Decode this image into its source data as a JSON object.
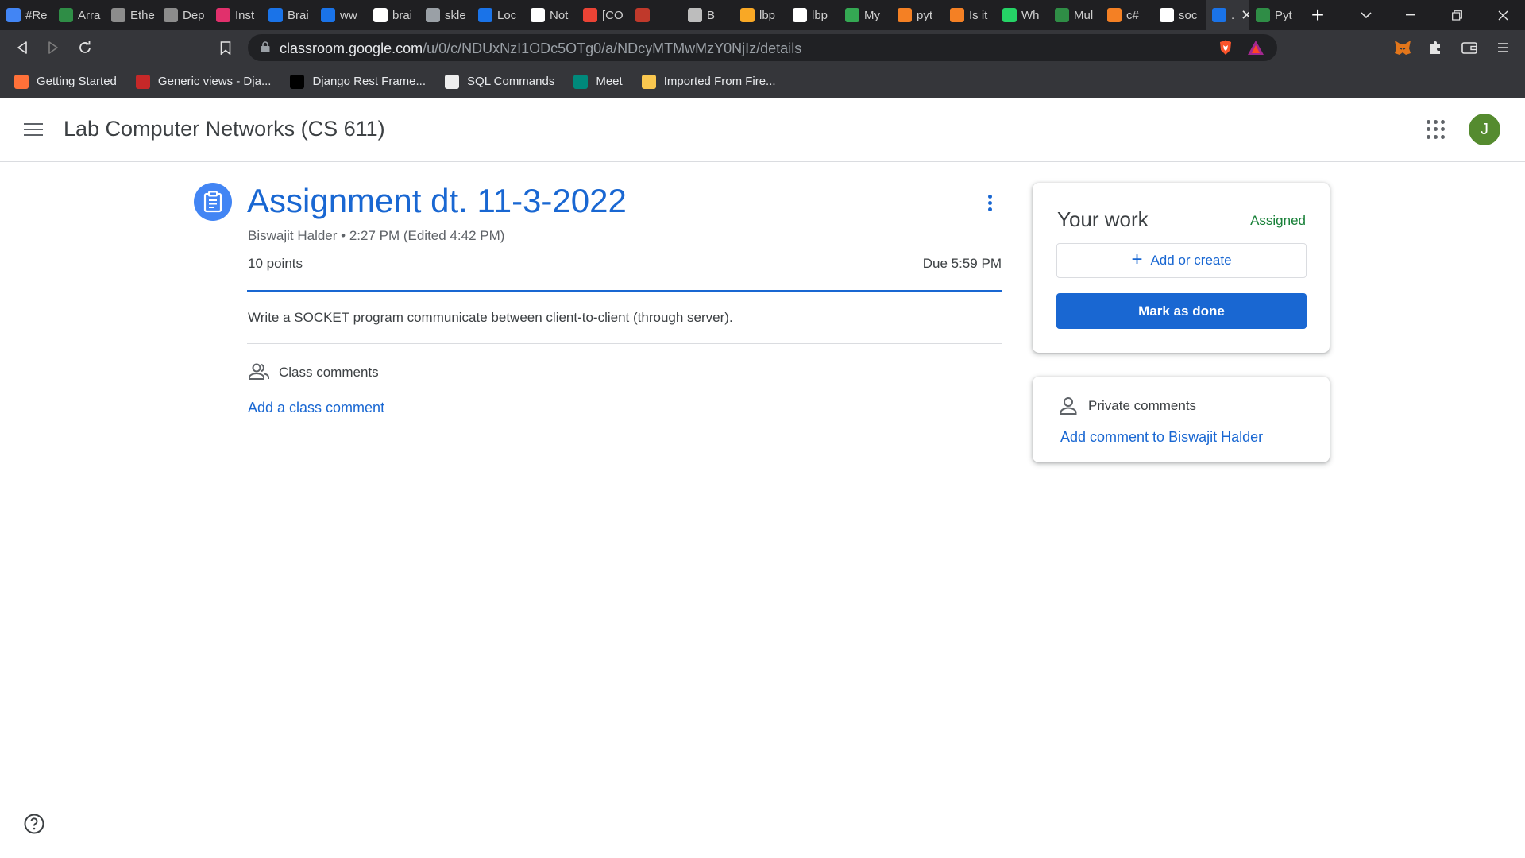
{
  "browser": {
    "tabs": [
      {
        "label": "#Re",
        "icon": "docs-icon",
        "color": "#4285f4"
      },
      {
        "label": "Arra",
        "icon": "gfg-icon",
        "color": "#2f8d46"
      },
      {
        "label": "Ethe",
        "icon": "ethereum-icon",
        "color": "#8c8c8c"
      },
      {
        "label": "Dep",
        "icon": "ethereum-icon",
        "color": "#8c8c8c"
      },
      {
        "label": "Inst",
        "icon": "instagram-icon",
        "color": "#e1306c"
      },
      {
        "label": "Brai",
        "icon": "k-icon",
        "color": "#1a73e8"
      },
      {
        "label": "ww",
        "icon": "k-icon",
        "color": "#1a73e8"
      },
      {
        "label": "brai",
        "icon": "github-icon",
        "color": "#ffffff"
      },
      {
        "label": "skle",
        "icon": "globe-icon",
        "color": "#9aa0a6"
      },
      {
        "label": "Loc",
        "icon": "p-icon",
        "color": "#1a73e8"
      },
      {
        "label": "Not",
        "icon": "notion-icon",
        "color": "#ffffff"
      },
      {
        "label": "[CO",
        "icon": "gmail-icon",
        "color": "#ea4335"
      },
      {
        "label": "",
        "icon": "tool-icon",
        "color": "#c0392b"
      },
      {
        "label": "B",
        "icon": "sparkle-icon",
        "color": "#bdbdbd"
      },
      {
        "label": "lbp",
        "icon": "infinity-icon",
        "color": "#f9a825"
      },
      {
        "label": "lbp",
        "icon": "github-icon",
        "color": "#ffffff"
      },
      {
        "label": "My",
        "icon": "drive-icon",
        "color": "#34a853"
      },
      {
        "label": "pyt",
        "icon": "stackoverflow-icon",
        "color": "#f48024"
      },
      {
        "label": "Is it",
        "icon": "stackoverflow-icon",
        "color": "#f48024"
      },
      {
        "label": "Wh",
        "icon": "whatsapp-icon",
        "color": "#25d366"
      },
      {
        "label": "Mul",
        "icon": "gfg-icon",
        "color": "#2f8d46"
      },
      {
        "label": "c#",
        "icon": "stackoverflow-icon",
        "color": "#f48024"
      },
      {
        "label": "soc",
        "icon": "google-icon",
        "color": "#ffffff"
      },
      {
        "label": ".",
        "icon": "classroom-icon",
        "color": "#1a73e8",
        "active": true
      },
      {
        "label": "Pyt",
        "icon": "gfg-icon",
        "color": "#2f8d46"
      }
    ],
    "url_host": "classroom.google.com",
    "url_path": "/u/0/c/NDUxNzI1ODc5OTg0/a/NDcyMTMwMzY0NjIz/details",
    "bookmarks": [
      {
        "label": "Getting Started",
        "icon": "firefox-icon",
        "color": "#ff7139"
      },
      {
        "label": "Generic views - Dja...",
        "icon": "django-icon",
        "color": "#c62828"
      },
      {
        "label": "Django Rest Frame...",
        "icon": "drf-icon",
        "color": "#000000"
      },
      {
        "label": "SQL Commands",
        "icon": "sql-icon",
        "color": "#eeeeee"
      },
      {
        "label": "Meet",
        "icon": "meet-icon",
        "color": "#00897b"
      },
      {
        "label": "Imported From Fire...",
        "icon": "folder-icon",
        "color": "#f9c74f"
      }
    ]
  },
  "header": {
    "course_title": "Lab Computer Networks (CS 611)",
    "avatar_letter": "J"
  },
  "assignment": {
    "title": "Assignment dt. 11-3-2022",
    "meta": "Biswajit Halder • 2:27 PM (Edited 4:42 PM)",
    "points": "10 points",
    "due": "Due 5:59 PM",
    "description": "Write a SOCKET program communicate between client-to-client (through server).",
    "class_comments_label": "Class comments",
    "add_class_comment": "Add a class comment"
  },
  "your_work": {
    "title": "Your work",
    "status": "Assigned",
    "add_or_create": "Add or create",
    "mark_done": "Mark as done"
  },
  "private_comments": {
    "label": "Private comments",
    "add": "Add comment to Biswajit Halder"
  }
}
